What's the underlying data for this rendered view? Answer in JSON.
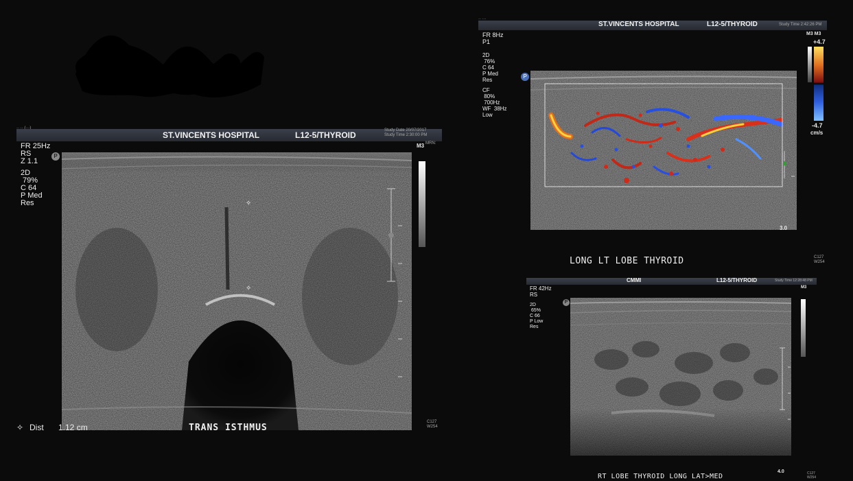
{
  "left_panel": {
    "hospital": "ST.VINCENTS HOSPITAL",
    "probe": "L12-5/THYROID",
    "study_date": "Study Date 20/07/2017",
    "study_time": "Study Time 2:30:00 PM",
    "mrn": "MRN:",
    "mode_tag": "M3",
    "params": "FR 25Hz\nRS\nZ 1.1",
    "params_2d_header": "2D",
    "params_2d": " 79%\nC 64\nP Med\nRes",
    "p_badge": "P",
    "dist_label": "Dist",
    "dist_value": "1.12 cm",
    "dist_marker": "✧",
    "caption": "TRANS   ISTHMUS",
    "footer": "C127\nW254"
  },
  "top_right_panel": {
    "hospital": "ST.VINCENTS HOSPITAL",
    "probe": "L12-5/THYROID",
    "study_time": "Study Time 2:42:26 PM",
    "mode_tag": "M3 M3",
    "params": "FR 8Hz\nP1",
    "params_2d_header": "2D",
    "params_2d": " 76%\nC 64\nP Med\nRes",
    "params_cf_header": "CF",
    "params_cf": " 80%\n 700Hz\nWF  38Hz\nLow",
    "p_badge": "P",
    "scale_max": "+4.7",
    "scale_min": "-4.7",
    "scale_unit": "cm/s",
    "depth": "3.0",
    "caption": "LONG  LT LOBE THYROID",
    "footer": "C127\nW254"
  },
  "bottom_right_panel": {
    "mode": "CMMI",
    "probe": "L12-5/THYROID",
    "study_time": "Study Time 12:28:48 PM",
    "mode_tag": "M3",
    "params": "FR 42Hz\nRS",
    "params_2d_header": "2D",
    "params_2d": " 65%\nC 66\nP Low\nRes",
    "p_badge": "P",
    "depth": "4.0",
    "caption": "RT LOBE THYROID  LONG  LAT>MED",
    "footer": "C127\nW254"
  },
  "colors": {
    "background": "#0b0b0b",
    "header_bar": "#2f333b",
    "doppler_red": "#d8301a",
    "doppler_blue": "#2850e0",
    "doppler_yellow": "#ffd040"
  }
}
